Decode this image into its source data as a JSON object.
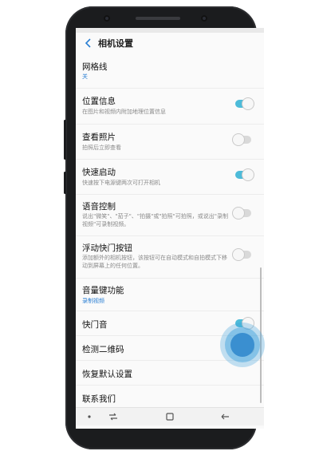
{
  "header": {
    "title": "相机设置"
  },
  "settings": [
    {
      "title": "网格线",
      "subtitle": "关",
      "toggle": null
    },
    {
      "title": "位置信息",
      "subtitle": "在图片和视频内附加地理位置信息",
      "toggle": true
    },
    {
      "title": "查看照片",
      "subtitle": "拍照后立即查看",
      "toggle": false
    },
    {
      "title": "快速启动",
      "subtitle": "快速按下电源键两次可打开相机",
      "toggle": true
    },
    {
      "title": "语音控制",
      "subtitle": "说出\"微笑\"、\"茄子\"、\"拍摄\"或\"拍照\"可拍照，或说出\"录制视频\"可录制视频。",
      "toggle": false
    },
    {
      "title": "浮动快门按钮",
      "subtitle": "添加额外的相机按钮，该按钮可在自动模式和自拍模式下移动到屏幕上的任何位置。",
      "toggle": false
    },
    {
      "title": "音量键功能",
      "subtitle": "录制视频",
      "toggle": null
    },
    {
      "title": "快门音",
      "subtitle": "",
      "toggle": true
    },
    {
      "title": "检测二维码",
      "subtitle": "",
      "toggle": true
    },
    {
      "title": "恢复默认设置",
      "subtitle": "",
      "toggle": null
    },
    {
      "title": "联系我们",
      "subtitle": "",
      "toggle": null
    }
  ],
  "colors": {
    "accent": "#2b7fd3",
    "toggle_on": "#4dbbd9",
    "toggle_off": "#d9d9d9"
  },
  "navbar": {
    "icons": [
      "dot-icon",
      "recent-apps-icon",
      "home-icon",
      "back-icon"
    ]
  }
}
